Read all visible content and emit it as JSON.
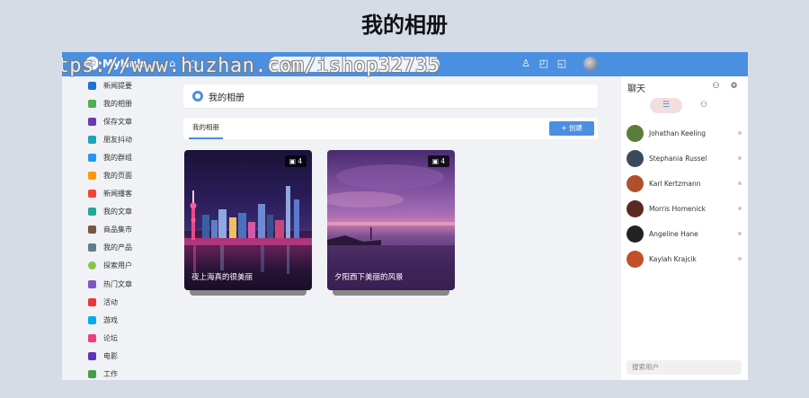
{
  "page_heading": "我的相册",
  "watermark": "https://www.huzhan.com/ishop32735",
  "topbar": {
    "logo_text": "MyHub",
    "search_placeholder": "搜索..."
  },
  "sidebar": {
    "items": [
      {
        "label": "新闻提要",
        "color": "#1f6fd1"
      },
      {
        "label": "我的相册",
        "color": "#4caf50"
      },
      {
        "label": "保存文章",
        "color": "#6a3ab2"
      },
      {
        "label": "朋友抖动",
        "color": "#1aa6b7"
      },
      {
        "label": "我的群组",
        "color": "#2196f3"
      },
      {
        "label": "我的页面",
        "color": "#ff9800"
      },
      {
        "label": "新闻播客",
        "color": "#f44336"
      },
      {
        "label": "我的文章",
        "color": "#26a69a"
      },
      {
        "label": "商品集市",
        "color": "#795548"
      },
      {
        "label": "我的产品",
        "color": "#607d8b"
      },
      {
        "label": "探索用户",
        "color": "#8bc34a"
      },
      {
        "label": "热门文章",
        "color": "#7e57c2"
      },
      {
        "label": "活动",
        "color": "#e53935"
      },
      {
        "label": "游戏",
        "color": "#03a9f4"
      },
      {
        "label": "论坛",
        "color": "#ec407a"
      },
      {
        "label": "电影",
        "color": "#5e35b1"
      },
      {
        "label": "工作",
        "color": "#43a047"
      }
    ]
  },
  "main": {
    "title": "我的相册",
    "tab_label": "我的相册",
    "create_label": "+ 创建",
    "albums": [
      {
        "caption": "夜上海真的很美丽",
        "count": "4"
      },
      {
        "caption": "夕阳西下美丽的风景",
        "count": "4"
      }
    ]
  },
  "chat": {
    "title": "聊天",
    "contacts": [
      {
        "name": "Johathan Keeling",
        "color": "#5a7d3a"
      },
      {
        "name": "Stephania Russel",
        "color": "#3a4a5a"
      },
      {
        "name": "Karl Kertzmann",
        "color": "#b0502a"
      },
      {
        "name": "Morris Homenick",
        "color": "#5a2a20"
      },
      {
        "name": "Angeline Hane",
        "color": "#222222"
      },
      {
        "name": "Kaylah Krajcik",
        "color": "#c0502a"
      }
    ],
    "search_placeholder": "搜索用户"
  },
  "colors": {
    "accent": "#4b8fe0",
    "background": "#d5dce6"
  }
}
